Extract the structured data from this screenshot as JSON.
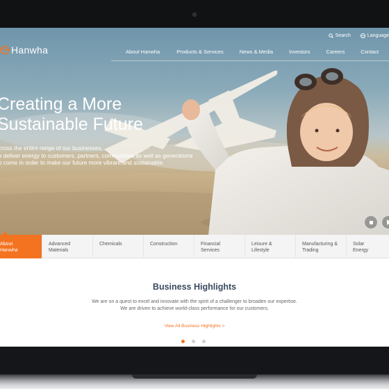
{
  "brand": {
    "logo_text": "Hanwha",
    "accent_color": "#f37321"
  },
  "utility": {
    "search_label": "Search",
    "language_label": "Language"
  },
  "nav": {
    "items": [
      {
        "label": "About Hanwha"
      },
      {
        "label": "Products & Services"
      },
      {
        "label": "News & Media"
      },
      {
        "label": "Investors"
      },
      {
        "label": "Careers"
      },
      {
        "label": "Contact"
      }
    ]
  },
  "hero": {
    "title_line1": "Creating a More",
    "title_line2": "Sustainable Future",
    "desc_line1": "cross the entire range of our businesses,",
    "desc_line2": "e deliver energy to customers, partners, communities as well as generations",
    "desc_line3": "o come in order to make our future more vibrant and sustainable."
  },
  "tabs": [
    {
      "line1": "About",
      "line2": "Hanwha"
    },
    {
      "line1": "Advanced",
      "line2": "Materials"
    },
    {
      "line1": "Chemicals",
      "line2": ""
    },
    {
      "line1": "Construction",
      "line2": ""
    },
    {
      "line1": "Financial",
      "line2": "Services"
    },
    {
      "line1": "Leisure &",
      "line2": "Lifestyle"
    },
    {
      "line1": "Manufacturing &",
      "line2": "Trading"
    },
    {
      "line1": "Solar",
      "line2": "Energy"
    }
  ],
  "highlights": {
    "title": "Business Highlights",
    "desc_line1": "We are on a quest to excel and innovate with the spirit of a challenger to broaden our expertise.",
    "desc_line2": "We are driven to achieve world-class performance for our customers.",
    "link_label": "View All Business Highlights >",
    "active_page": 1,
    "page_count": 3
  }
}
